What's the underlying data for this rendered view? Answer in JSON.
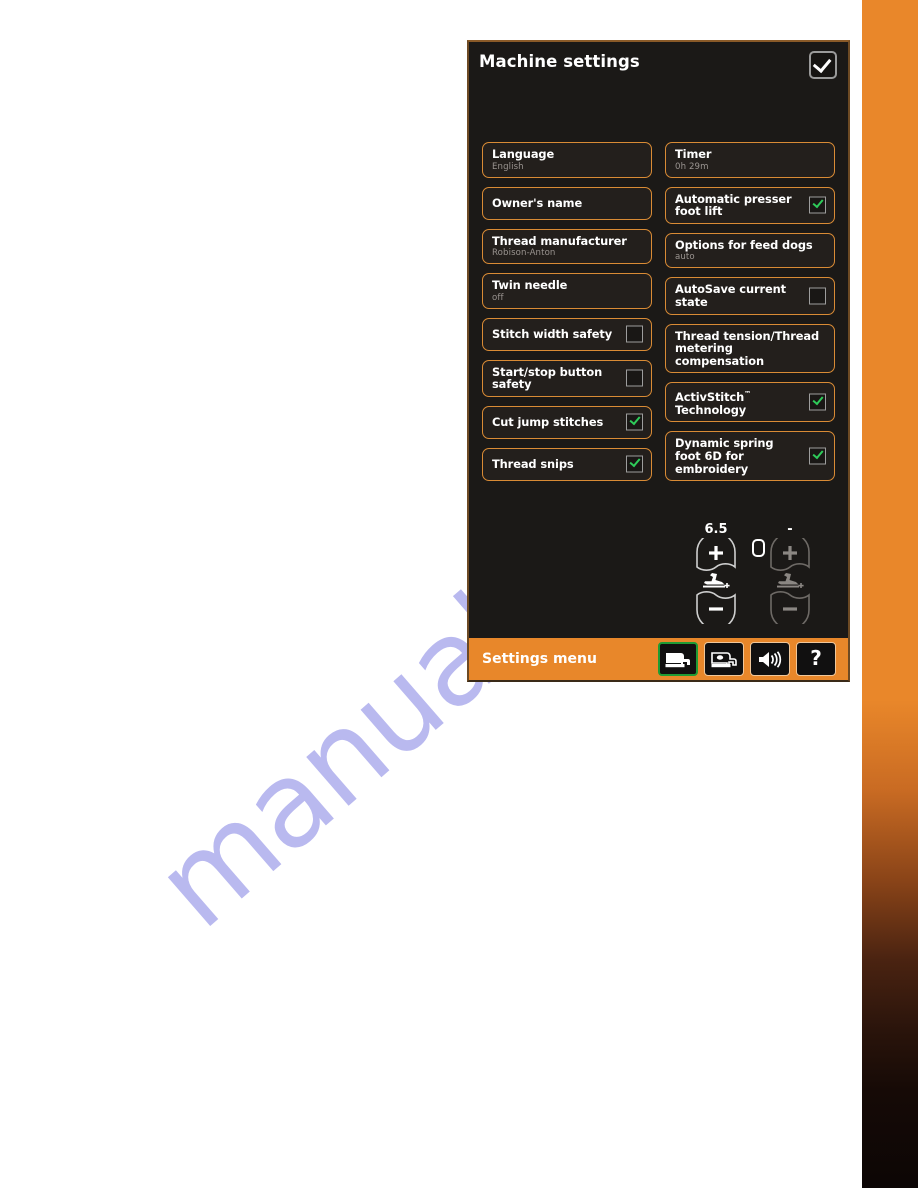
{
  "page": {
    "watermark_text": "manualshive.c",
    "edge_strip_color": "#E9872A"
  },
  "screen": {
    "title": "Machine settings",
    "ok_button_label": "OK",
    "accent_color": "#D98B35",
    "bottom_bar_color": "#E8872A",
    "check_color": "#2ecc5a"
  },
  "settings": {
    "left_column": [
      {
        "label": "Language",
        "value": "English",
        "has_checkbox": false,
        "checked": false
      },
      {
        "label": "Owner's name",
        "value": "",
        "has_checkbox": false,
        "checked": false
      },
      {
        "label": "Thread manufacturer",
        "value": "Robison-Anton",
        "has_checkbox": false,
        "checked": false
      },
      {
        "label": "Twin needle",
        "value": "off",
        "has_checkbox": false,
        "checked": false
      },
      {
        "label": "Stitch width safety",
        "value": "",
        "has_checkbox": true,
        "checked": false
      },
      {
        "label": "Start/stop button safety",
        "value": "",
        "has_checkbox": true,
        "checked": false
      },
      {
        "label": "Cut jump stitches",
        "value": "",
        "has_checkbox": true,
        "checked": true
      },
      {
        "label": "Thread snips",
        "value": "",
        "has_checkbox": true,
        "checked": true
      }
    ],
    "right_column": [
      {
        "label": "Timer",
        "value": "0h  29m",
        "has_checkbox": false,
        "checked": false
      },
      {
        "label": "Automatic presser foot lift",
        "value": "",
        "has_checkbox": true,
        "checked": true
      },
      {
        "label": "Options for feed dogs",
        "value": "auto",
        "has_checkbox": false,
        "checked": false
      },
      {
        "label": "AutoSave current state",
        "value": "",
        "has_checkbox": true,
        "checked": false
      },
      {
        "label": "Thread tension/Thread metering compensation",
        "value": "",
        "has_checkbox": false,
        "checked": false
      },
      {
        "label": "ActivStitch™ Technology",
        "value": "",
        "has_checkbox": true,
        "checked": true
      },
      {
        "label": "Dynamic spring foot 6D for embroidery",
        "value": "",
        "has_checkbox": true,
        "checked": true
      }
    ]
  },
  "steppers": [
    {
      "name": "presser-foot-height",
      "value": "6.5",
      "enabled": true
    },
    {
      "name": "presser-foot-pressure",
      "value": "-",
      "enabled": false
    }
  ],
  "bottom_bar": {
    "label": "Settings menu",
    "buttons": [
      {
        "name": "machine-settings",
        "icon": "sewing-machine-filled-icon",
        "active": true
      },
      {
        "name": "embroidery-settings",
        "icon": "sewing-machine-outline-icon",
        "active": false
      },
      {
        "name": "sound-settings",
        "icon": "speaker-icon",
        "active": false
      },
      {
        "name": "help",
        "icon": "question-mark-icon",
        "active": false
      }
    ]
  }
}
